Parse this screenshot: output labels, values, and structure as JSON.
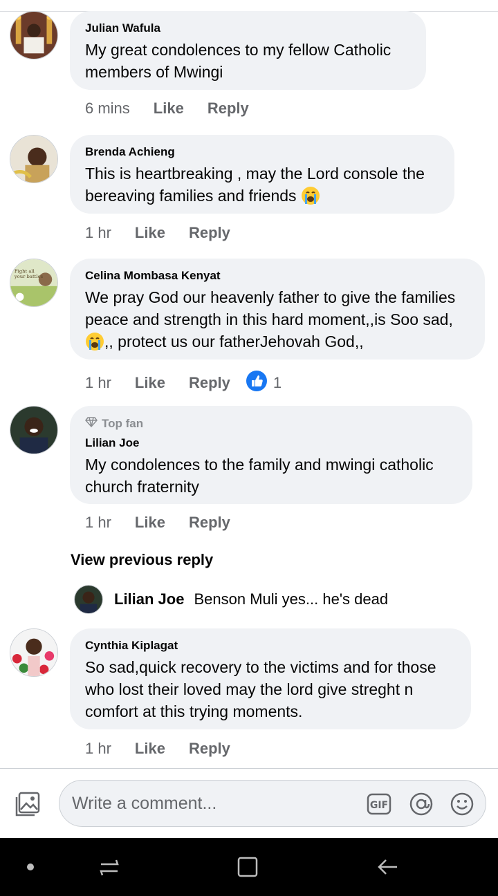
{
  "comments": [
    {
      "name": "Julian Wafula",
      "text": "My great condolences to my fellow Catholic members of Mwingi",
      "time": "6 mins",
      "like": "Like",
      "reply": "Reply"
    },
    {
      "name": "Brenda Achieng",
      "text": "This is heartbreaking , may the Lord console the bereaving families and friends",
      "emoji": "crying-face",
      "time": "1 hr",
      "like": "Like",
      "reply": "Reply"
    },
    {
      "name": "Celina Mombasa Kenyat",
      "text_line1": "We pray God our heavenly father to give the families peace and strength in this hard moment,,is Soo sad,",
      "text_line2": ",, protect us our fatherJehovah God,,",
      "emoji": "crying-face",
      "time": "1 hr",
      "like": "Like",
      "reply": "Reply",
      "reaction": "like-reaction",
      "reaction_count": "1"
    },
    {
      "badge": "Top fan",
      "name": "Lilian Joe",
      "text": "My condolences to the family and mwingi catholic church fraternity",
      "time": "1 hr",
      "like": "Like",
      "reply": "Reply"
    },
    {
      "name": "Cynthia Kiplagat",
      "text": "So sad,quick recovery to the victims and for those who lost their loved may the lord give streght n comfort at this trying moments.",
      "time": "1 hr",
      "like": "Like",
      "reply": "Reply"
    }
  ],
  "view_previous": "View previous reply",
  "reply_preview": {
    "name": "Lilian Joe",
    "text": "Benson Muli yes... he's dead"
  },
  "composer": {
    "placeholder": "Write a comment...",
    "icons": [
      "photo-icon",
      "gif-icon",
      "mention-icon",
      "emoji-icon"
    ]
  },
  "navbar": {
    "icons": [
      "dot-icon",
      "recents-icon",
      "home-icon",
      "back-icon"
    ]
  },
  "colors": {
    "bubble": "#f0f2f5",
    "meta_text": "#65676b",
    "like_blue": "#1877f2"
  }
}
